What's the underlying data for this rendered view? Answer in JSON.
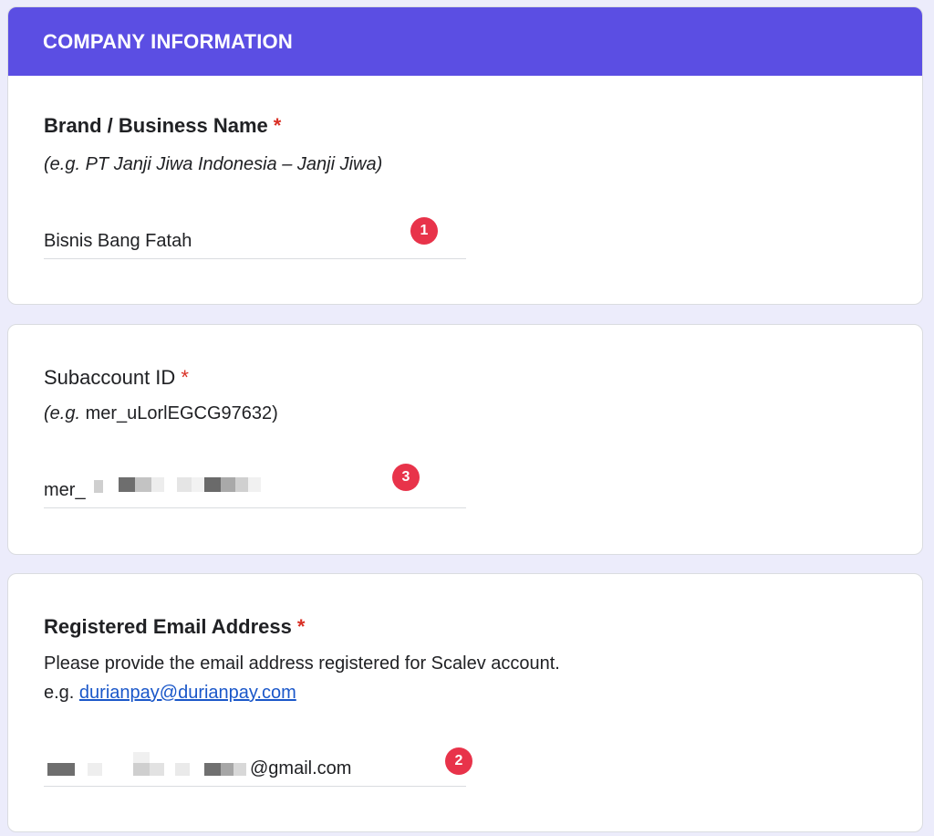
{
  "company_section": {
    "header": "COMPANY INFORMATION",
    "label": "Brand / Business Name",
    "required_mark": "*",
    "hint": "(e.g. PT Janji Jiwa Indonesia – Janji Jiwa)",
    "value": "Bisnis Bang Fatah",
    "badge": "1"
  },
  "subaccount_section": {
    "label": "Subaccount ID",
    "required_mark": "*",
    "hint_italic": "(e.g.",
    "hint_rest": " mer_uLorlEGCG97632)",
    "value_prefix": "mer_",
    "badge": "3"
  },
  "email_section": {
    "label": "Registered Email Address",
    "required_mark": "*",
    "description": "Please provide the email address registered for Scalev account.",
    "example_prefix": "e.g. ",
    "example_link": "durianpay@durianpay.com",
    "value_suffix": "@gmail.com",
    "badge": "2"
  },
  "colors": {
    "accent": "#5b4ee3",
    "required": "#d93025",
    "badge": "#e8334a",
    "link": "#1a57c9",
    "background": "#ececfb"
  }
}
